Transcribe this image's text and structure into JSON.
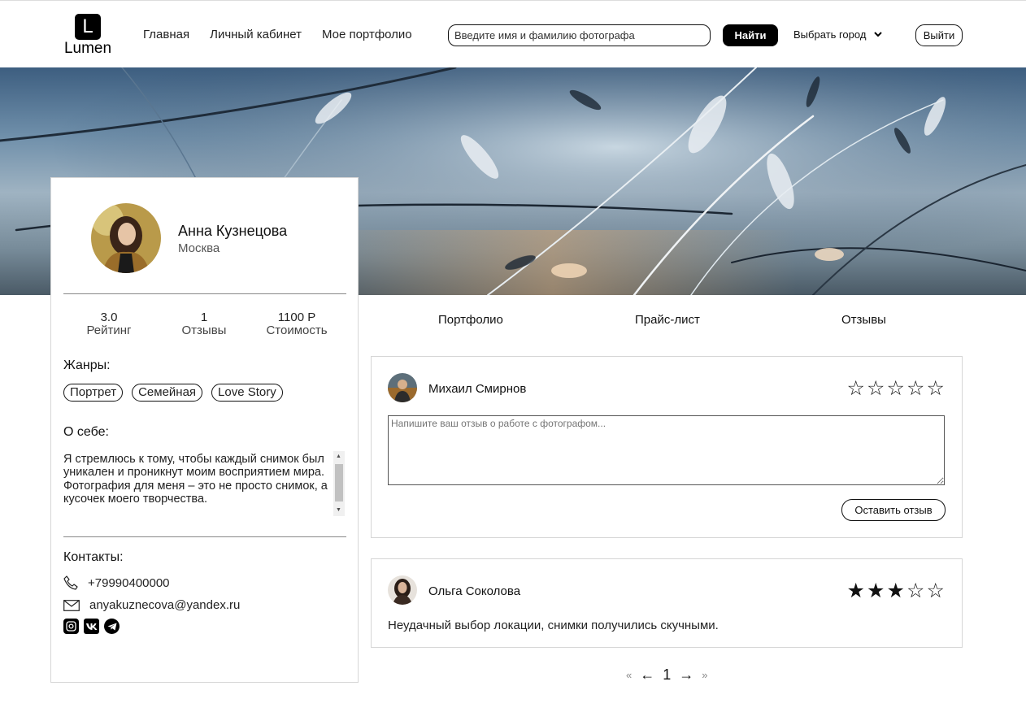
{
  "header": {
    "logo_letter": "L",
    "logo_text": "Lumen",
    "nav": [
      "Главная",
      "Личный кабинет",
      "Мое портфолио"
    ],
    "search_placeholder": "Введите имя и фамилию фотографа",
    "find_label": "Найти",
    "city_label": "Выбрать город",
    "logout_label": "Выйти"
  },
  "profile": {
    "name": "Анна Кузнецова",
    "city": "Москва",
    "stats": [
      {
        "value": "3.0",
        "label": "Рейтинг"
      },
      {
        "value": "1",
        "label": "Отзывы"
      },
      {
        "value": "1100 Р",
        "label": "Стоимость"
      }
    ],
    "genres_title": "Жанры:",
    "genres": [
      "Портрет",
      "Семейная",
      "Love Story"
    ],
    "about_title": "О себе:",
    "about_text": "Я стремлюсь к тому, чтобы каждый снимок был уникален и проникнут моим восприятием мира. Фотография для меня – это не просто снимок, а кусочек моего творчества.",
    "contacts_title": "Контакты:",
    "phone": "+79990400000",
    "email": "anyakuznecova@yandex.ru",
    "socials": [
      "instagram-icon",
      "vk-icon",
      "telegram-icon"
    ]
  },
  "tabs": [
    "Портфолио",
    "Прайс-лист",
    "Отзывы"
  ],
  "review_form": {
    "author": "Михаил Смирнов",
    "rating": 0,
    "placeholder": "Напишите ваш отзыв о работе с фотографом...",
    "submit_label": "Оставить отзыв"
  },
  "reviews": [
    {
      "author": "Ольга Соколова",
      "rating": 3,
      "text": "Неудачный выбор локации, снимки получились скучными."
    }
  ],
  "pagination": {
    "first": "«",
    "prev": "←",
    "current": "1",
    "next": "→",
    "last": "»"
  },
  "colors": {
    "accent": "#000000",
    "border": "#d6d6d6"
  }
}
